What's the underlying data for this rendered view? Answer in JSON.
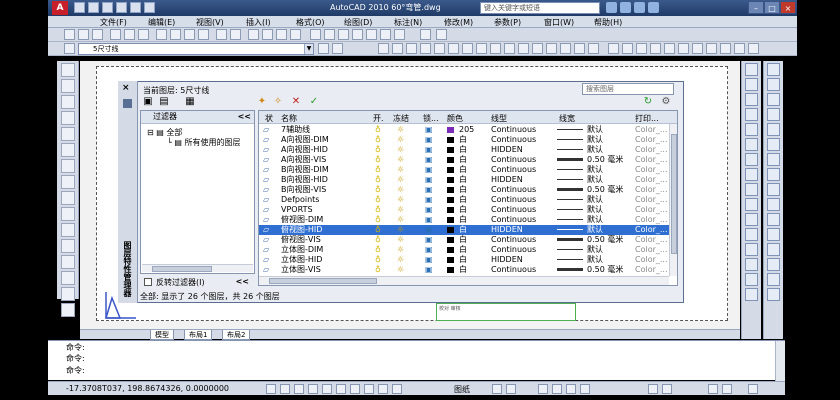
{
  "titlebar": {
    "app_icon": "A",
    "title": "AutoCAD 2010    60°弯管.dwg",
    "search_placeholder": "键入关键字或短语",
    "min": "–",
    "max": "□",
    "close": "×"
  },
  "menu": [
    "文件(F)",
    "编辑(E)",
    "视图(V)",
    "插入(I)",
    "格式(O)",
    "绘图(D)",
    "标注(N)",
    "修改(M)",
    "参数(P)",
    "窗口(W)",
    "帮助(H)"
  ],
  "toolbar2": {
    "layer_combo": "5尺寸线"
  },
  "layer_manager": {
    "close": "×",
    "current_layer_label": "当前图层: 5尺寸线",
    "search_placeholder": "搜索图层",
    "side_title": "图层特性管理器",
    "filters_header": "过滤器",
    "collapse": "<<",
    "tree": {
      "all": "全部",
      "used": "所有使用的图层"
    },
    "invert_filter": "反转过滤器(I)",
    "columns": {
      "status": "状",
      "name": "名称",
      "on": "开.",
      "freeze": "冻结",
      "lock": "锁...",
      "color": "颜色",
      "linetype": "线型",
      "lineweight": "线宽",
      "plot": "打印..."
    },
    "rows": [
      {
        "name": "7辅助线",
        "color_name": "205",
        "swatch": "#7a2cb8",
        "linetype": "Continuous",
        "lineweight": "默认",
        "thick": false,
        "plot": "Color_..."
      },
      {
        "name": "A向视图-DIM",
        "color_name": "白",
        "swatch": "#000000",
        "linetype": "Continuous",
        "lineweight": "默认",
        "thick": false,
        "plot": "Color_..."
      },
      {
        "name": "A向视图-HID",
        "color_name": "白",
        "swatch": "#000000",
        "linetype": "HIDDEN",
        "lineweight": "默认",
        "thick": false,
        "plot": "Color_..."
      },
      {
        "name": "A向视图-VIS",
        "color_name": "白",
        "swatch": "#000000",
        "linetype": "Continuous",
        "lineweight": "0.50 毫米",
        "thick": true,
        "plot": "Color_..."
      },
      {
        "name": "B向视图-DIM",
        "color_name": "白",
        "swatch": "#000000",
        "linetype": "Continuous",
        "lineweight": "默认",
        "thick": false,
        "plot": "Color_..."
      },
      {
        "name": "B向视图-HID",
        "color_name": "白",
        "swatch": "#000000",
        "linetype": "HIDDEN",
        "lineweight": "默认",
        "thick": false,
        "plot": "Color_..."
      },
      {
        "name": "B向视图-VIS",
        "color_name": "白",
        "swatch": "#000000",
        "linetype": "Continuous",
        "lineweight": "0.50 毫米",
        "thick": true,
        "plot": "Color_..."
      },
      {
        "name": "Defpoints",
        "color_name": "白",
        "swatch": "#000000",
        "linetype": "Continuous",
        "lineweight": "默认",
        "thick": false,
        "plot": "Color_..."
      },
      {
        "name": "VPORTS",
        "color_name": "白",
        "swatch": "#000000",
        "linetype": "Continuous",
        "lineweight": "默认",
        "thick": false,
        "plot": "Color_..."
      },
      {
        "name": "俯视图-DIM",
        "color_name": "白",
        "swatch": "#000000",
        "linetype": "Continuous",
        "lineweight": "默认",
        "thick": false,
        "plot": "Color_..."
      },
      {
        "name": "俯视图-HID",
        "color_name": "白",
        "swatch": "#000000",
        "linetype": "HIDDEN",
        "lineweight": "默认",
        "thick": false,
        "plot": "Color_...",
        "selected": true
      },
      {
        "name": "俯视图-VIS",
        "color_name": "白",
        "swatch": "#000000",
        "linetype": "Continuous",
        "lineweight": "0.50 毫米",
        "thick": true,
        "plot": "Color_..."
      },
      {
        "name": "立体图-DIM",
        "color_name": "白",
        "swatch": "#000000",
        "linetype": "Continuous",
        "lineweight": "默认",
        "thick": false,
        "plot": "Color_..."
      },
      {
        "name": "立体图-HID",
        "color_name": "白",
        "swatch": "#000000",
        "linetype": "HIDDEN",
        "lineweight": "默认",
        "thick": false,
        "plot": "Color_..."
      },
      {
        "name": "立体图-VIS",
        "color_name": "白",
        "swatch": "#000000",
        "linetype": "Continuous",
        "lineweight": "0.50 毫米",
        "thick": true,
        "plot": "Color_..."
      }
    ],
    "status_text": "全部: 显示了 26 个图层，共 26 个图层"
  },
  "layout_tabs": [
    "模型",
    "布局1",
    "布局2"
  ],
  "titleblock_text": "校对\n审核",
  "command": {
    "line1": "命令:",
    "line2": "命令:",
    "line3": "命令:"
  },
  "status": {
    "coords": "-17.3708T037, 198.8674326, 0.0000000",
    "model": "图纸"
  }
}
